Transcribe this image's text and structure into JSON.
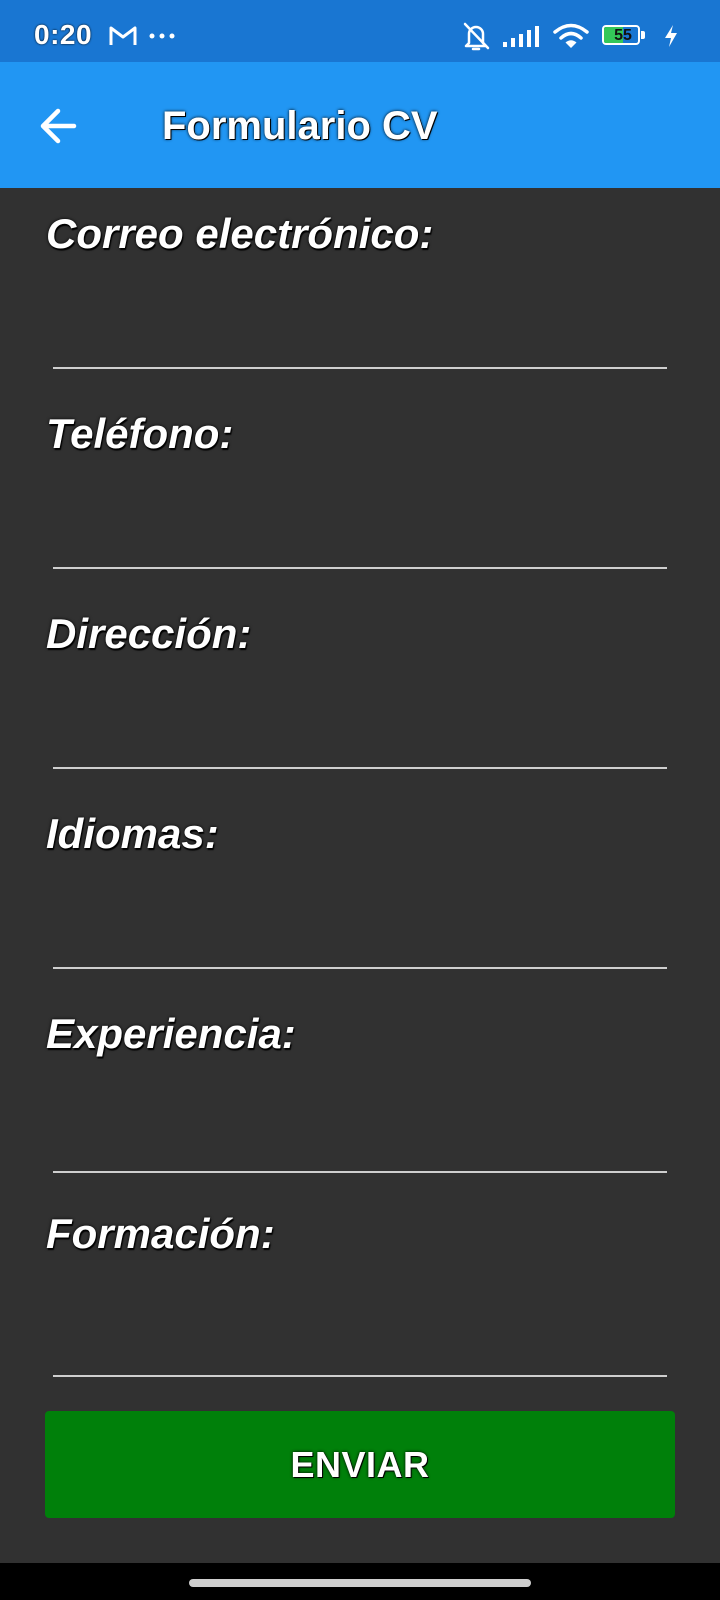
{
  "status_bar": {
    "time": "0:20",
    "icons": [
      "gmail-icon",
      "more-dots-icon",
      "bell-off-icon",
      "signal-icon",
      "wifi-icon",
      "battery-icon",
      "charging-icon"
    ],
    "battery_level": "55",
    "battery_fraction": 0.55
  },
  "app_bar": {
    "title": "Formulario CV",
    "back_icon": "arrow-left-icon",
    "background": "#2196f3"
  },
  "form": {
    "fields": [
      {
        "label": "Correo electrónico:",
        "value": ""
      },
      {
        "label": "Teléfono:",
        "value": ""
      },
      {
        "label": "Dirección:",
        "value": ""
      },
      {
        "label": "Idiomas:",
        "value": ""
      },
      {
        "label": "Experiencia:",
        "value": ""
      },
      {
        "label": "Formación:",
        "value": ""
      }
    ],
    "submit_label": "ENVIAR",
    "submit_color": "#00800a",
    "background": "#313131"
  }
}
